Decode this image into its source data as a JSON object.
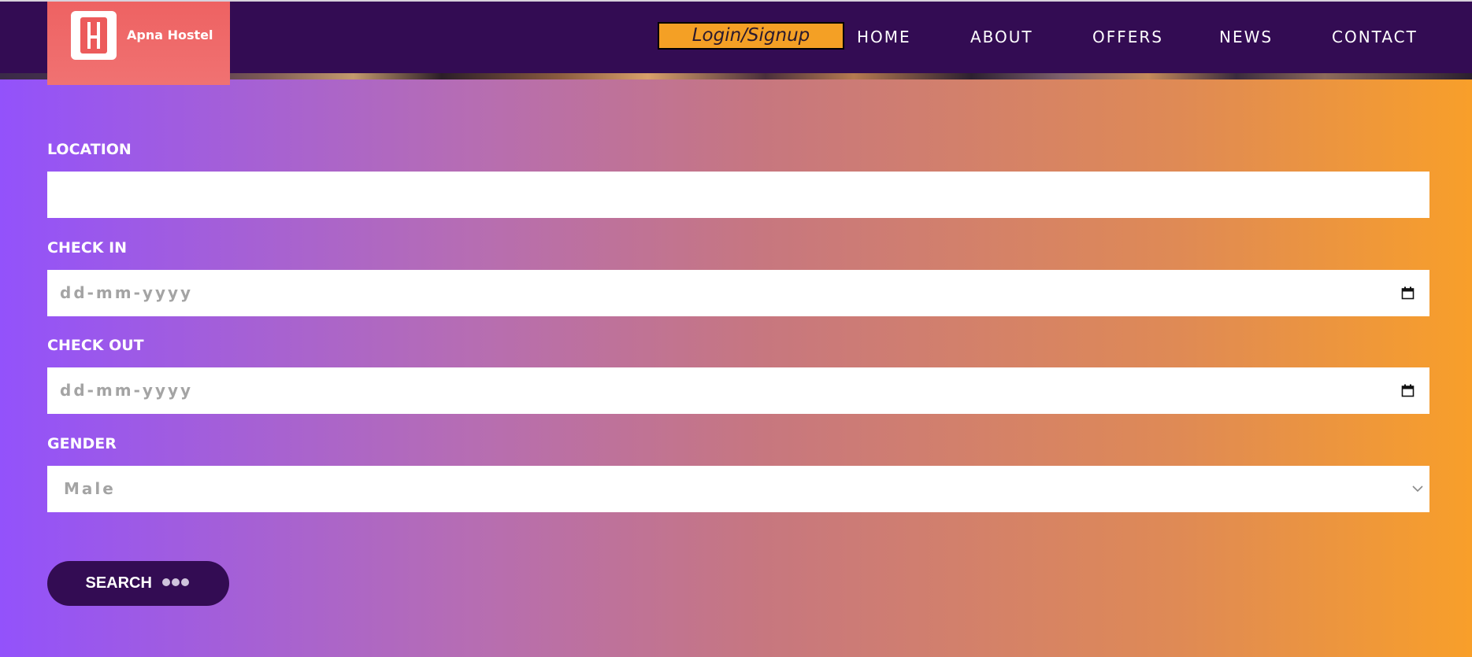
{
  "brand": {
    "name": "Apna Hostel"
  },
  "header": {
    "login_label": "Login/Signup",
    "nav": [
      "HOME",
      "ABOUT",
      "OFFERS",
      "NEWS",
      "CONTACT"
    ]
  },
  "form": {
    "location": {
      "label": "LOCATION",
      "value": ""
    },
    "check_in": {
      "label": "CHECK IN",
      "value": "dd-mm-yyyy"
    },
    "check_out": {
      "label": "CHECK OUT",
      "value": "dd-mm-yyyy"
    },
    "gender": {
      "label": "GENDER",
      "value": "Male"
    },
    "search_label": "SEARCH"
  },
  "icons": [
    "logo-icon",
    "calendar-icon",
    "chevron-down-icon",
    "loading-dots-icon"
  ],
  "colors": {
    "header_bg": "#330c53",
    "accent_orange": "#f4a025",
    "logo_red": "#ee6262",
    "gradient_start": "#9352fb",
    "gradient_end": "#f89f2a"
  }
}
